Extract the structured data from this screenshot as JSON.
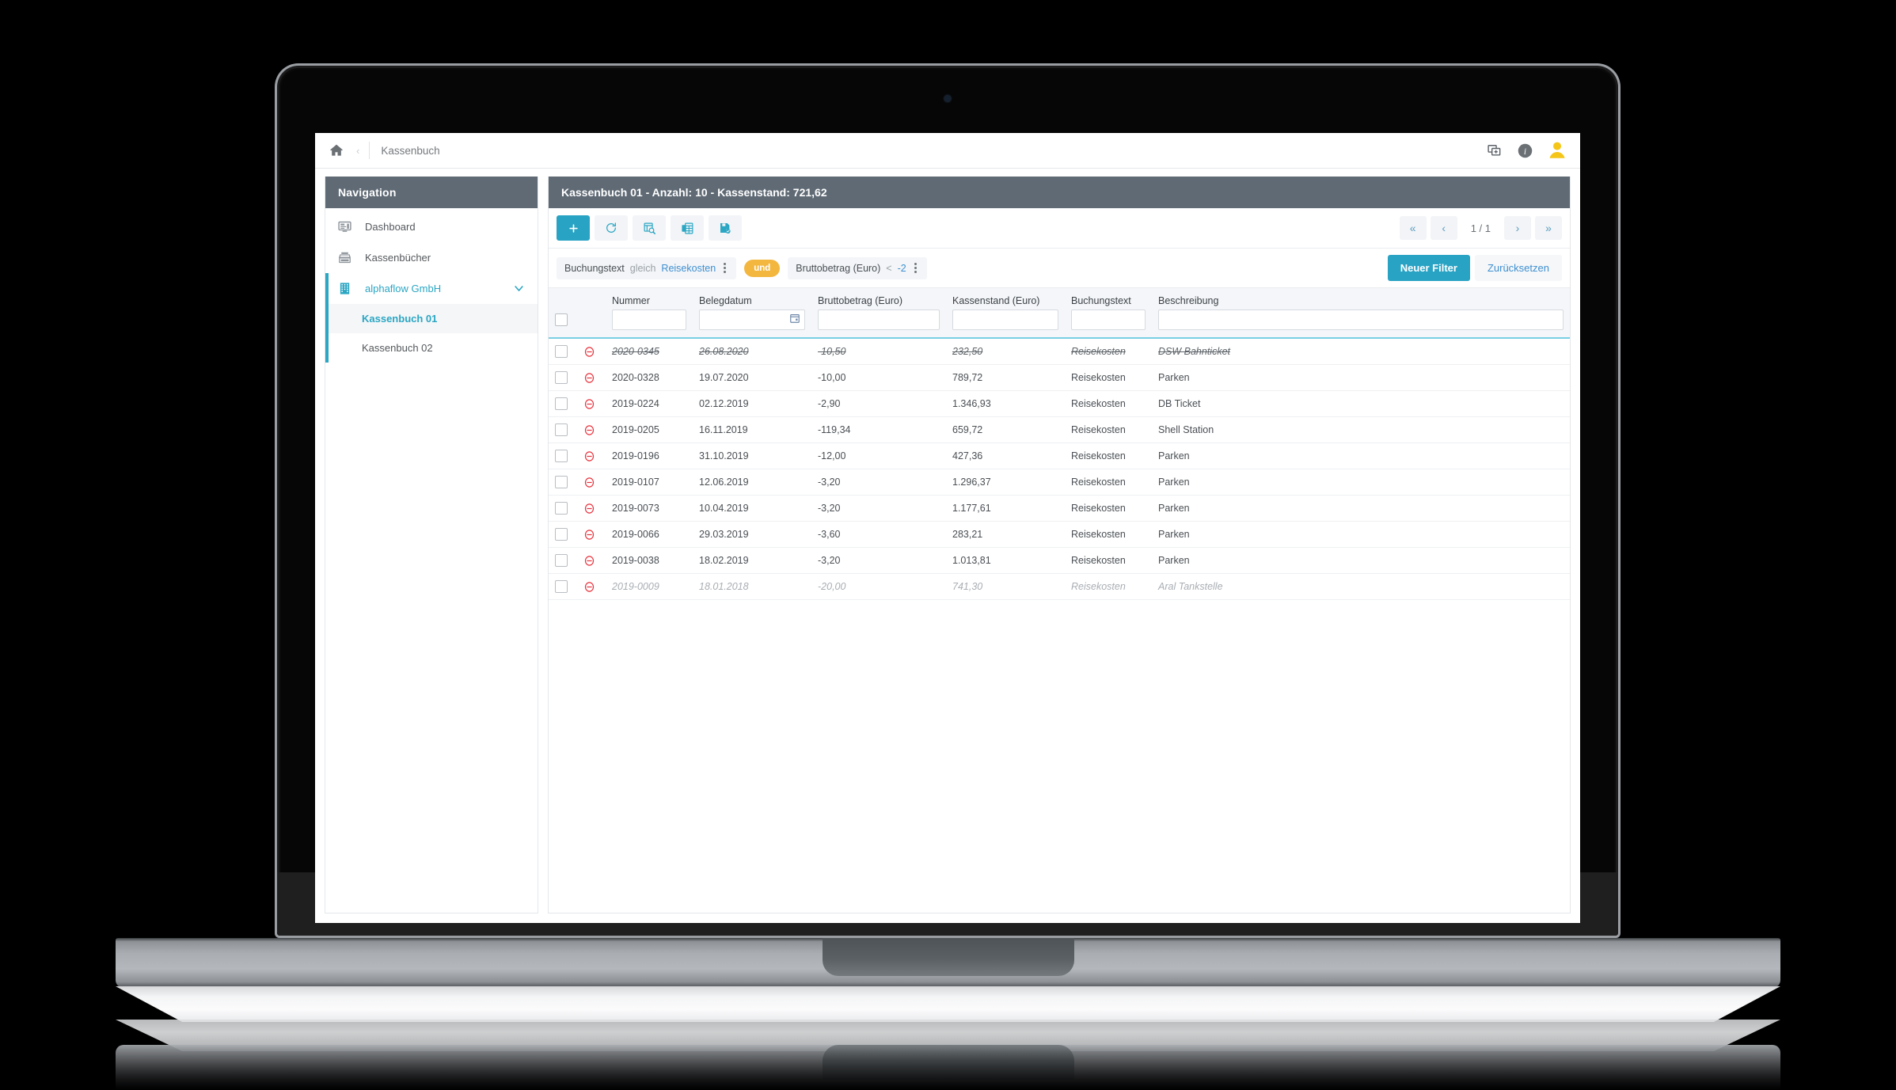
{
  "header": {
    "home_icon": "home-icon",
    "breadcrumb_separator": "‹",
    "breadcrumb_title": "Kassenbuch",
    "copy_icon": "add-window-icon",
    "info_icon": "info-icon",
    "avatar_icon": "user-avatar-icon"
  },
  "sidebar": {
    "title": "Navigation",
    "items": [
      {
        "label": "Dashboard",
        "icon": "monitor-icon"
      },
      {
        "label": "Kassenbücher",
        "icon": "cash-register-icon"
      },
      {
        "label": "alphaflow GmbH",
        "icon": "building-icon",
        "expanded": true
      }
    ],
    "subitems": [
      {
        "label": "Kassenbuch 01",
        "selected": true
      },
      {
        "label": "Kassenbuch 02",
        "selected": false
      }
    ]
  },
  "main": {
    "title": "Kassenbuch 01 - Anzahl: 10 - Kassenstand: 721,62",
    "toolbar": {
      "add_label": "+",
      "buttons": [
        {
          "name": "add-button",
          "icon": "plus-icon"
        },
        {
          "name": "refresh-button",
          "icon": "refresh-icon"
        },
        {
          "name": "search-document-button",
          "icon": "document-search-icon"
        },
        {
          "name": "excel-export-button",
          "icon": "excel-icon"
        },
        {
          "name": "save-button",
          "icon": "save-check-icon"
        }
      ]
    },
    "pagination": {
      "first": "«",
      "prev": "‹",
      "page_label": "1 / 1",
      "next": "›",
      "last": "»"
    },
    "filters": {
      "chip1": {
        "field": "Buchungstext",
        "operator": "gleich",
        "value": "Reisekosten"
      },
      "conjunction": "und",
      "chip2": {
        "field": "Bruttobetrag (Euro)",
        "operator": "<",
        "value": "-2"
      },
      "new_filter_label": "Neuer Filter",
      "reset_label": "Zurücksetzen"
    },
    "table": {
      "columns": [
        "Nummer",
        "Belegdatum",
        "Bruttobetrag (Euro)",
        "Kassenstand (Euro)",
        "Buchungstext",
        "Beschreibung"
      ],
      "filter_values": [
        "",
        "",
        "",
        "",
        "",
        ""
      ],
      "rows": [
        {
          "nummer": "2020-0345",
          "belegdatum": "26.08.2020",
          "brutto": "-10,50",
          "kassenstand": "232,50",
          "buchungstext": "Reisekosten",
          "beschreibung": "DSW Bahnticket",
          "style": "strike"
        },
        {
          "nummer": "2020-0328",
          "belegdatum": "19.07.2020",
          "brutto": "-10,00",
          "kassenstand": "789,72",
          "buchungstext": "Reisekosten",
          "beschreibung": "Parken",
          "style": "normal"
        },
        {
          "nummer": "2019-0224",
          "belegdatum": "02.12.2019",
          "brutto": "-2,90",
          "kassenstand": "1.346,93",
          "buchungstext": "Reisekosten",
          "beschreibung": "DB Ticket",
          "style": "normal"
        },
        {
          "nummer": "2019-0205",
          "belegdatum": "16.11.2019",
          "brutto": "-119,34",
          "kassenstand": "659,72",
          "buchungstext": "Reisekosten",
          "beschreibung": "Shell Station",
          "style": "normal"
        },
        {
          "nummer": "2019-0196",
          "belegdatum": "31.10.2019",
          "brutto": "-12,00",
          "kassenstand": "427,36",
          "buchungstext": "Reisekosten",
          "beschreibung": "Parken",
          "style": "normal"
        },
        {
          "nummer": "2019-0107",
          "belegdatum": "12.06.2019",
          "brutto": "-3,20",
          "kassenstand": "1.296,37",
          "buchungstext": "Reisekosten",
          "beschreibung": "Parken",
          "style": "normal"
        },
        {
          "nummer": "2019-0073",
          "belegdatum": "10.04.2019",
          "brutto": "-3,20",
          "kassenstand": "1.177,61",
          "buchungstext": "Reisekosten",
          "beschreibung": "Parken",
          "style": "normal"
        },
        {
          "nummer": "2019-0066",
          "belegdatum": "29.03.2019",
          "brutto": "-3,60",
          "kassenstand": "283,21",
          "buchungstext": "Reisekosten",
          "beschreibung": "Parken",
          "style": "normal"
        },
        {
          "nummer": "2019-0038",
          "belegdatum": "18.02.2019",
          "brutto": "-3,20",
          "kassenstand": "1.013,81",
          "buchungstext": "Reisekosten",
          "beschreibung": "Parken",
          "style": "normal"
        },
        {
          "nummer": "2019-0009",
          "belegdatum": "18.01.2018",
          "brutto": "-20,00",
          "kassenstand": "741,30",
          "buchungstext": "Reisekosten",
          "beschreibung": "Aral Tankstelle",
          "style": "muted"
        }
      ]
    }
  },
  "colors": {
    "accent": "#29a3c4",
    "header_bar": "#5f6a75",
    "conjunction": "#f3b740",
    "link": "#3e8fd0",
    "delete": "#e8323c",
    "avatar": "#f5c518"
  }
}
